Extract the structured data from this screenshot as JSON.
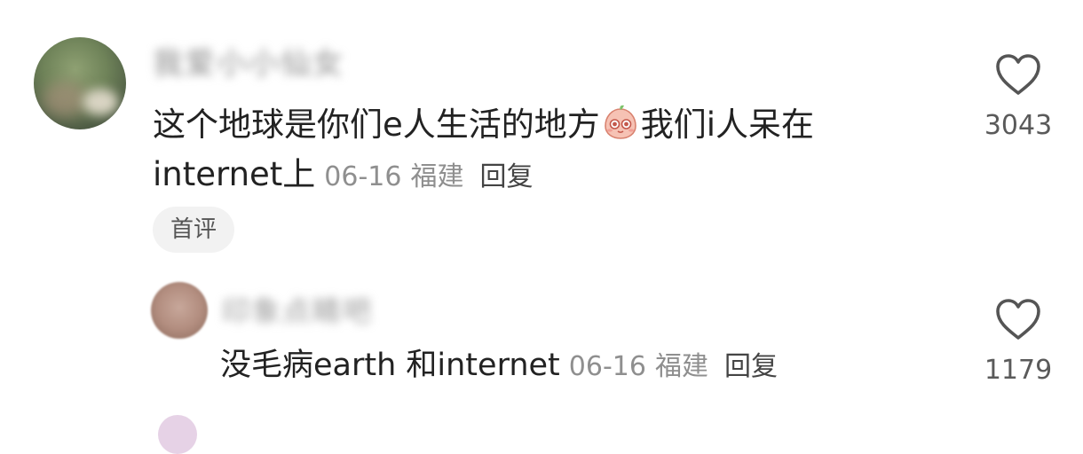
{
  "main_comment": {
    "username": "我爱小小仙女",
    "text_part1": "这个地球是你们e人生活的地方",
    "emoji": "peach-face-emoji",
    "text_part2": "我们i人呆在internet上",
    "date": "06-16",
    "region": "福建",
    "reply_label": "回复",
    "badge": "首评",
    "like_count": "3043"
  },
  "reply_comment": {
    "username": "印象点睛吧",
    "text": "没毛病earth 和internet",
    "date": "06-16",
    "region": "福建",
    "reply_label": "回复",
    "like_count": "1179"
  },
  "icons": {
    "like": "heart-outline-icon",
    "emoji": "peach-face-emoji"
  },
  "colors": {
    "text": "#222222",
    "meta": "#8f8f8f",
    "badge_bg": "#f2f2f2",
    "heart_stroke": "#555555"
  }
}
